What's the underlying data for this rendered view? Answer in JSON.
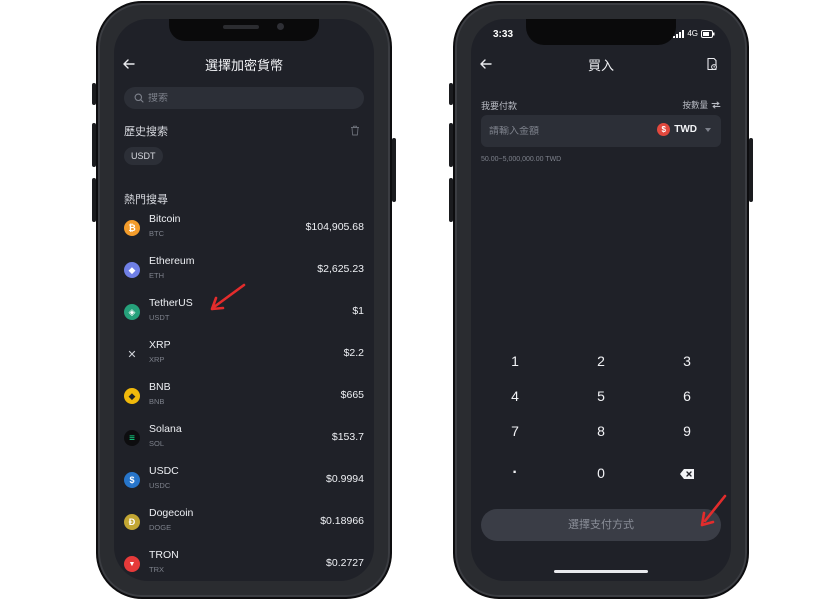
{
  "left": {
    "header": {
      "title": "選擇加密貨幣"
    },
    "search": {
      "placeholder": "搜索"
    },
    "history": {
      "title": "歷史搜索",
      "chip": "USDT"
    },
    "trending": {
      "title": "熱門搜尋"
    },
    "coins": [
      {
        "name": "Bitcoin",
        "symbol": "BTC",
        "price": "$104,905.68",
        "icon_color": "#f39c2b",
        "icon_glyph": "₿"
      },
      {
        "name": "Ethereum",
        "symbol": "ETH",
        "price": "$2,625.23",
        "icon_color": "#6f7fe5",
        "icon_glyph": "◆"
      },
      {
        "name": "TetherUS",
        "symbol": "USDT",
        "price": "$1",
        "icon_color": "#26a17b",
        "icon_glyph": "◈"
      },
      {
        "name": "XRP",
        "symbol": "XRP",
        "price": "$2.2",
        "icon_color": "#1f2128",
        "icon_glyph": "✕"
      },
      {
        "name": "BNB",
        "symbol": "BNB",
        "price": "$665",
        "icon_color": "#f0b90b",
        "icon_glyph": "◆"
      },
      {
        "name": "Solana",
        "symbol": "SOL",
        "price": "$153.7",
        "icon_color": "#111111",
        "icon_glyph": "≡"
      },
      {
        "name": "USDC",
        "symbol": "USDC",
        "price": "$0.9994",
        "icon_color": "#2775ca",
        "icon_glyph": "$"
      },
      {
        "name": "Dogecoin",
        "symbol": "DOGE",
        "price": "$0.18966",
        "icon_color": "#c2a633",
        "icon_glyph": "Ð"
      },
      {
        "name": "TRON",
        "symbol": "TRX",
        "price": "$0.2727",
        "icon_color": "#e63a3a",
        "icon_glyph": "▼"
      }
    ]
  },
  "right": {
    "status": {
      "time": "3:33",
      "network": "4G"
    },
    "header": {
      "title": "買入"
    },
    "pay_label": "我要付款",
    "by_qty": "按數量",
    "amount": {
      "placeholder": "請輸入金額",
      "currency": "TWD"
    },
    "range": "50.00~5,000,000.00 TWD",
    "keys": [
      "1",
      "2",
      "3",
      "4",
      "5",
      "6",
      "7",
      "8",
      "9",
      "·",
      "0",
      "⌫"
    ],
    "pay_button": "選擇支付方式"
  },
  "colors": {
    "accent_red": "#e32c2c",
    "screen_bg": "#1f2128",
    "panel_bg": "#2c2f37"
  }
}
